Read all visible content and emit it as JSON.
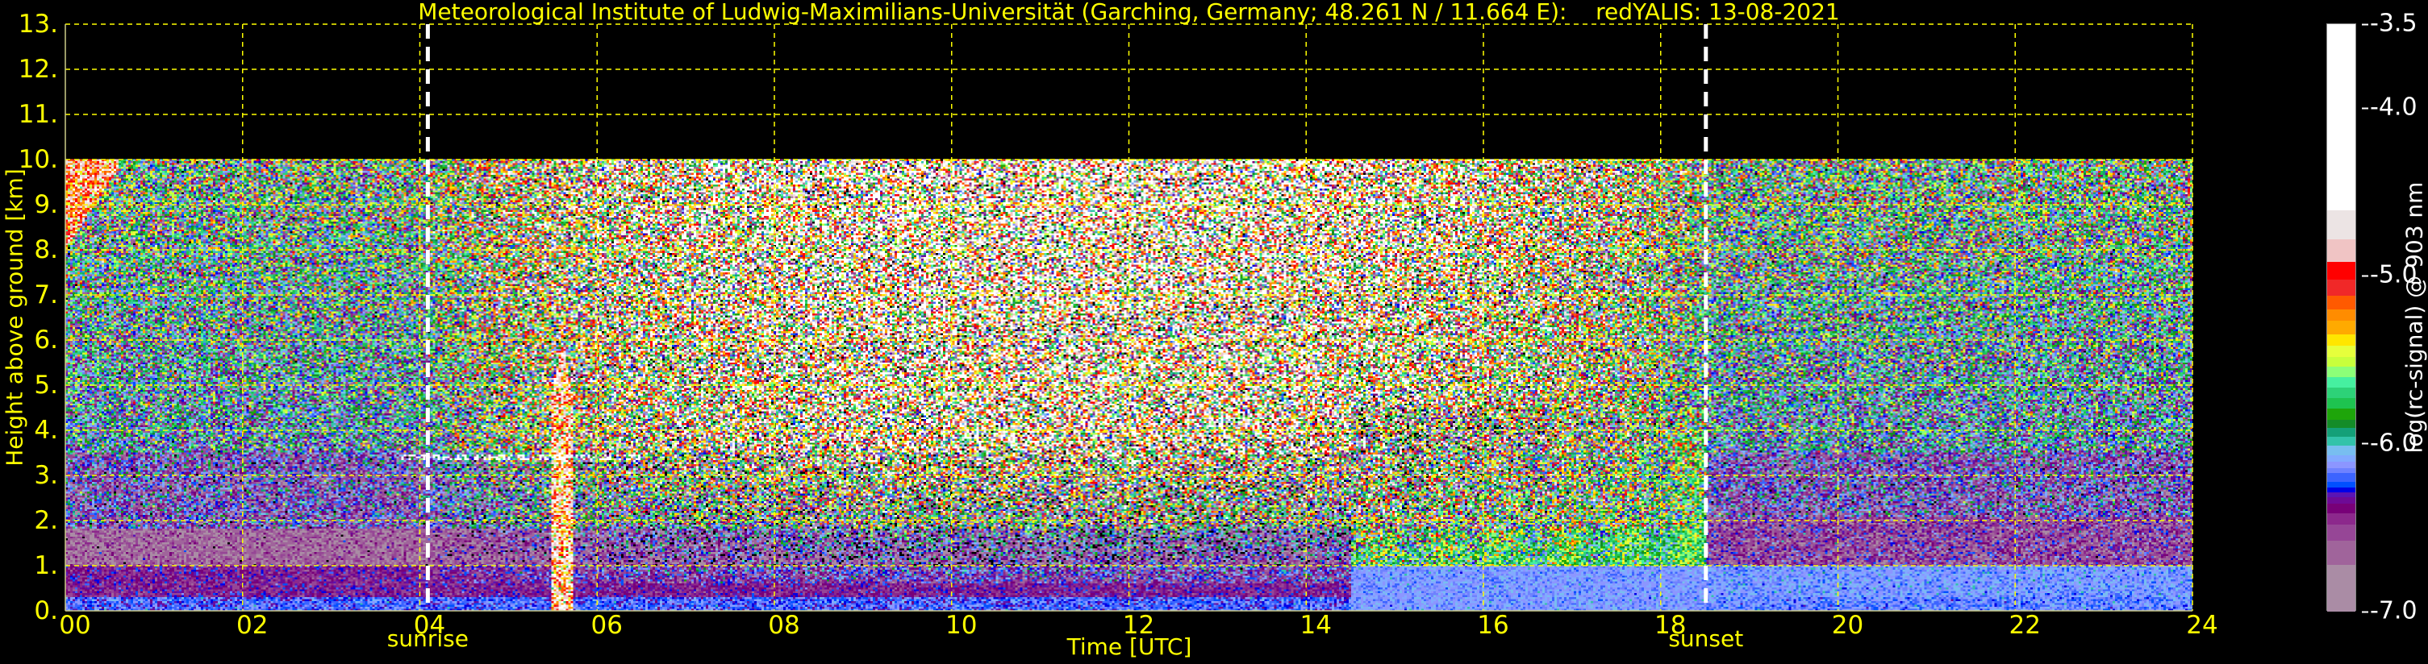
{
  "chart_data": {
    "type": "heatmap",
    "title": "Meteorological Institute of Ludwig-Maximilians-Universität (Garching, Germany; 48.261 N / 11.664 E):    redYALIS: 13-08-2021",
    "xlabel": "Time [UTC]",
    "ylabel": "Height above ground [km]",
    "xlim": [
      0,
      24
    ],
    "ylim": [
      0,
      13
    ],
    "data_top_km": 10,
    "grid": true,
    "xticks": [
      {
        "value": 0,
        "label": "00"
      },
      {
        "value": 2,
        "label": "02"
      },
      {
        "value": 4,
        "label": "04"
      },
      {
        "value": 6,
        "label": "06"
      },
      {
        "value": 8,
        "label": "08"
      },
      {
        "value": 10,
        "label": "10"
      },
      {
        "value": 12,
        "label": "12"
      },
      {
        "value": 14,
        "label": "14"
      },
      {
        "value": 16,
        "label": "16"
      },
      {
        "value": 18,
        "label": "18"
      },
      {
        "value": 20,
        "label": "20"
      },
      {
        "value": 22,
        "label": "22"
      },
      {
        "value": 24,
        "label": "24"
      }
    ],
    "yticks": [
      {
        "value": 0,
        "label": "0."
      },
      {
        "value": 1,
        "label": "1."
      },
      {
        "value": 2,
        "label": "2."
      },
      {
        "value": 3,
        "label": "3."
      },
      {
        "value": 4,
        "label": "4."
      },
      {
        "value": 5,
        "label": "5."
      },
      {
        "value": 6,
        "label": "6."
      },
      {
        "value": 7,
        "label": "7."
      },
      {
        "value": 8,
        "label": "8."
      },
      {
        "value": 9,
        "label": "9."
      },
      {
        "value": 10,
        "label": "10."
      },
      {
        "value": 11,
        "label": "11."
      },
      {
        "value": 12,
        "label": "12."
      },
      {
        "value": 13,
        "label": "13."
      }
    ],
    "annotations": [
      {
        "label": "sunrise",
        "time": 4.09
      },
      {
        "label": "sunset",
        "time": 18.51
      }
    ],
    "features": {
      "boundary_layer_top_km_night": 1.8,
      "cloud_layer_km": 3.4,
      "cloud_layer_hours": [
        3.8,
        6.5
      ],
      "precip_plume_hour": 5.6,
      "cirrus_hours": [
        0,
        0.6
      ],
      "cirrus_km": [
        8,
        10
      ],
      "evening_aerosol_layer_km": 1.6,
      "evening_aerosol_hours": [
        19.5,
        24
      ]
    },
    "colorbar": {
      "label": "log(rc-signal) @ 903 nm",
      "range": [
        -7.0,
        -3.5
      ],
      "ticks": [
        {
          "value": -3.5,
          "label": "-3.5"
        },
        {
          "value": -4.0,
          "label": "-4.0"
        },
        {
          "value": -5.0,
          "label": "-5.0"
        },
        {
          "value": -6.0,
          "label": "-6.0"
        },
        {
          "value": -7.0,
          "label": "-7.0"
        }
      ],
      "bands": [
        {
          "from": -7.0,
          "to": -6.721,
          "color": "#aa8ca5"
        },
        {
          "from": -6.721,
          "to": -6.577,
          "color": "#a0649b"
        },
        {
          "from": -6.577,
          "to": -6.481,
          "color": "#964696"
        },
        {
          "from": -6.481,
          "to": -6.413,
          "color": "#8c288c"
        },
        {
          "from": -6.413,
          "to": -6.355,
          "color": "#780078"
        },
        {
          "from": -6.355,
          "to": -6.317,
          "color": "#6e0a96"
        },
        {
          "from": -6.317,
          "to": -6.287,
          "color": "#5a14b4"
        },
        {
          "from": -6.287,
          "to": -6.256,
          "color": "#0000e6"
        },
        {
          "from": -6.256,
          "to": -6.224,
          "color": "#0050ff"
        },
        {
          "from": -6.224,
          "to": -6.173,
          "color": "#3c64ff"
        },
        {
          "from": -6.173,
          "to": -6.143,
          "color": "#6e82ff"
        },
        {
          "from": -6.143,
          "to": -6.105,
          "color": "#8c96ff"
        },
        {
          "from": -6.105,
          "to": -6.065,
          "color": "#82aaff"
        },
        {
          "from": -6.065,
          "to": -6.009,
          "color": "#78bef0"
        },
        {
          "from": -6.009,
          "to": -5.954,
          "color": "#32c3aa"
        },
        {
          "from": -5.954,
          "to": -5.903,
          "color": "#14a078"
        },
        {
          "from": -5.903,
          "to": -5.853,
          "color": "#148c28"
        },
        {
          "from": -5.853,
          "to": -5.79,
          "color": "#1ea50a"
        },
        {
          "from": -5.79,
          "to": -5.727,
          "color": "#1ec350"
        },
        {
          "from": -5.727,
          "to": -5.664,
          "color": "#2dd278"
        },
        {
          "from": -5.664,
          "to": -5.601,
          "color": "#46f0a0"
        },
        {
          "from": -5.601,
          "to": -5.538,
          "color": "#8cff78"
        },
        {
          "from": -5.538,
          "to": -5.48,
          "color": "#c8ff3c"
        },
        {
          "from": -5.48,
          "to": -5.412,
          "color": "#e6ff3c"
        },
        {
          "from": -5.412,
          "to": -5.346,
          "color": "#ffe600"
        },
        {
          "from": -5.346,
          "to": -5.265,
          "color": "#ffaa00"
        },
        {
          "from": -5.265,
          "to": -5.195,
          "color": "#ff8c00"
        },
        {
          "from": -5.195,
          "to": -5.114,
          "color": "#ff5a00"
        },
        {
          "from": -5.114,
          "to": -5.018,
          "color": "#f02828"
        },
        {
          "from": -5.018,
          "to": -4.912,
          "color": "#ff0000"
        },
        {
          "from": -4.912,
          "to": -4.781,
          "color": "#f0c4c4"
        },
        {
          "from": -4.781,
          "to": -4.605,
          "color": "#ece4e4"
        },
        {
          "from": -4.605,
          "to": -3.5,
          "color": "#ffffff"
        }
      ]
    },
    "colors": {
      "axis_text": "#ffff00",
      "grid": "#ffff00",
      "sun_lines": "#ffffff",
      "background": "#000000"
    }
  }
}
